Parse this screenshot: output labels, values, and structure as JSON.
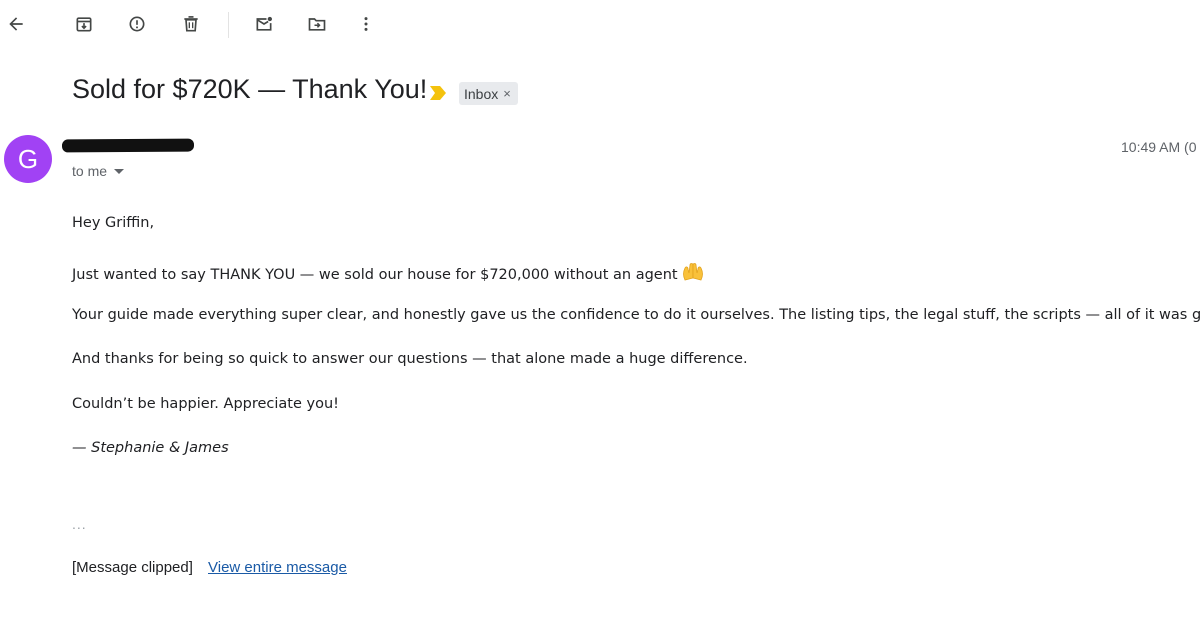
{
  "toolbar": {
    "icons": [
      "back-arrow-icon",
      "archive-icon",
      "report-spam-icon",
      "delete-icon",
      "mark-unread-icon",
      "move-to-icon",
      "more-vert-icon"
    ]
  },
  "email": {
    "subject": "Sold for $720K — Thank You!",
    "label": "Inbox",
    "label_close": "×",
    "sender_initial": "G",
    "avatar_color": "#a142f4",
    "to": "to me",
    "time": "10:49 AM (0",
    "body": {
      "greeting": "Hey Griffin,",
      "p1": "Just wanted to say THANK YOU — we sold our house for $720,000 without an agent",
      "p2": "Your guide made everything super clear, and honestly gave us the confidence to do it ourselves. The listing tips, the legal stuff, the scripts — all of it was gold",
      "p3": "And thanks for being so quick to answer our questions — that alone made a huge difference.",
      "p4": "Couldn’t be happier. Appreciate you!",
      "signature": "— Stephanie & James"
    },
    "ellipsis": "...",
    "clipped_text": "[Message clipped]",
    "view_link": "View entire message"
  },
  "colors": {
    "link": "#1a5aa6",
    "importance": "#f4c20d",
    "chip_bg": "#e8eaed"
  }
}
